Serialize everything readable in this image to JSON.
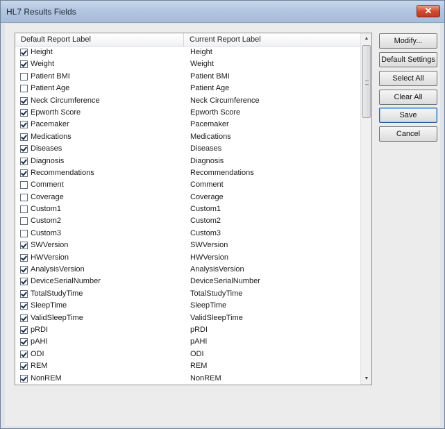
{
  "window": {
    "title": "HL7 Results Fields",
    "close_glyph": "✕"
  },
  "list": {
    "columns": [
      "Default Report Label",
      "Current Report Label"
    ],
    "rows": [
      {
        "checked": true,
        "default": "Height",
        "current": "Height"
      },
      {
        "checked": true,
        "default": "Weight",
        "current": "Weight"
      },
      {
        "checked": false,
        "default": "Patient BMI",
        "current": "Patient BMI"
      },
      {
        "checked": false,
        "default": "Patient Age",
        "current": "Patient Age"
      },
      {
        "checked": true,
        "default": "Neck Circumference",
        "current": "Neck Circumference"
      },
      {
        "checked": true,
        "default": "Epworth Score",
        "current": "Epworth Score"
      },
      {
        "checked": true,
        "default": "Pacemaker",
        "current": "Pacemaker"
      },
      {
        "checked": true,
        "default": "Medications",
        "current": "Medications"
      },
      {
        "checked": true,
        "default": "Diseases",
        "current": "Diseases"
      },
      {
        "checked": true,
        "default": "Diagnosis",
        "current": "Diagnosis"
      },
      {
        "checked": true,
        "default": "Recommendations",
        "current": "Recommendations"
      },
      {
        "checked": false,
        "default": "Comment",
        "current": "Comment"
      },
      {
        "checked": false,
        "default": "Coverage",
        "current": "Coverage"
      },
      {
        "checked": false,
        "default": "Custom1",
        "current": "Custom1"
      },
      {
        "checked": false,
        "default": "Custom2",
        "current": "Custom2"
      },
      {
        "checked": false,
        "default": "Custom3",
        "current": "Custom3"
      },
      {
        "checked": true,
        "default": "SWVersion",
        "current": "SWVersion"
      },
      {
        "checked": true,
        "default": "HWVersion",
        "current": "HWVersion"
      },
      {
        "checked": true,
        "default": "AnalysisVersion",
        "current": "AnalysisVersion"
      },
      {
        "checked": true,
        "default": "DeviceSerialNumber",
        "current": "DeviceSerialNumber"
      },
      {
        "checked": true,
        "default": "TotalStudyTime",
        "current": "TotalStudyTime"
      },
      {
        "checked": true,
        "default": "SleepTime",
        "current": "SleepTime"
      },
      {
        "checked": true,
        "default": "ValidSleepTime",
        "current": "ValidSleepTime"
      },
      {
        "checked": true,
        "default": "pRDI",
        "current": "pRDI"
      },
      {
        "checked": true,
        "default": "pAHI",
        "current": "pAHI"
      },
      {
        "checked": true,
        "default": "ODI",
        "current": "ODI"
      },
      {
        "checked": true,
        "default": "REM",
        "current": "REM"
      },
      {
        "checked": true,
        "default": "NonREM",
        "current": "NonREM"
      }
    ]
  },
  "buttons": {
    "modify": "Modify...",
    "default_settings": "Default Settings",
    "select_all": "Select All",
    "clear_all": "Clear All",
    "save": "Save",
    "cancel": "Cancel"
  },
  "scrollbar": {
    "up_glyph": "▲",
    "down_glyph": "▼"
  }
}
